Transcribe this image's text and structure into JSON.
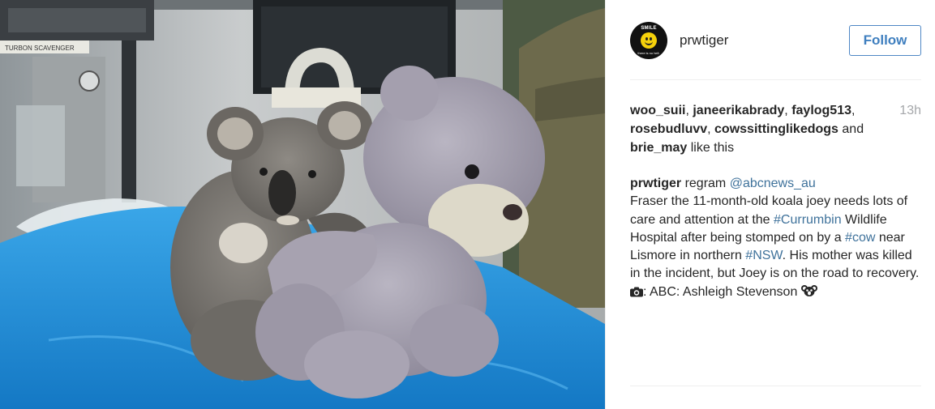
{
  "post": {
    "username": "prwtiger",
    "follow_label": "Follow",
    "avatar": {
      "top_text": "SMILE",
      "bottom_text": "there is no hell."
    },
    "timestamp": "13h",
    "likes": {
      "users": [
        "woo_suii",
        "janeerikabrady",
        "faylog513",
        "rosebudluvv",
        "cowssittinglikedogs",
        "brie_may"
      ],
      "sep": ", ",
      "and_text": " and ",
      "like_text": " like this"
    },
    "caption": {
      "author": "prwtiger",
      "regram_text": " regram ",
      "regram_handle": "@abcnews_au",
      "part1": "Fraser the 11-month-old koala joey needs lots of care and attention at the ",
      "tag_currumbin": "#Currumbin",
      "part2": " Wildlife Hospital after being stomped on by a ",
      "tag_cow": "#cow",
      "part3": " near Lismore in northern ",
      "tag_nsw": "#NSW",
      "part4": ". His mother was killed in the incident, but Joey is on the road to recovery. ",
      "camera_icon": "camera-icon",
      "part5": ": ABC: Ashleigh Stevenson ",
      "koala_icon": "koala-face-icon"
    }
  },
  "photo": {
    "sign_text": "TURBON SCAVENGER",
    "description_icon": "koala-hugging-teddy-bear-photo"
  },
  "colors": {
    "link": "#3f729b",
    "follow_border": "#4e87c5",
    "timestamp": "#a5a7aa",
    "drape": "#1f8fd6"
  }
}
